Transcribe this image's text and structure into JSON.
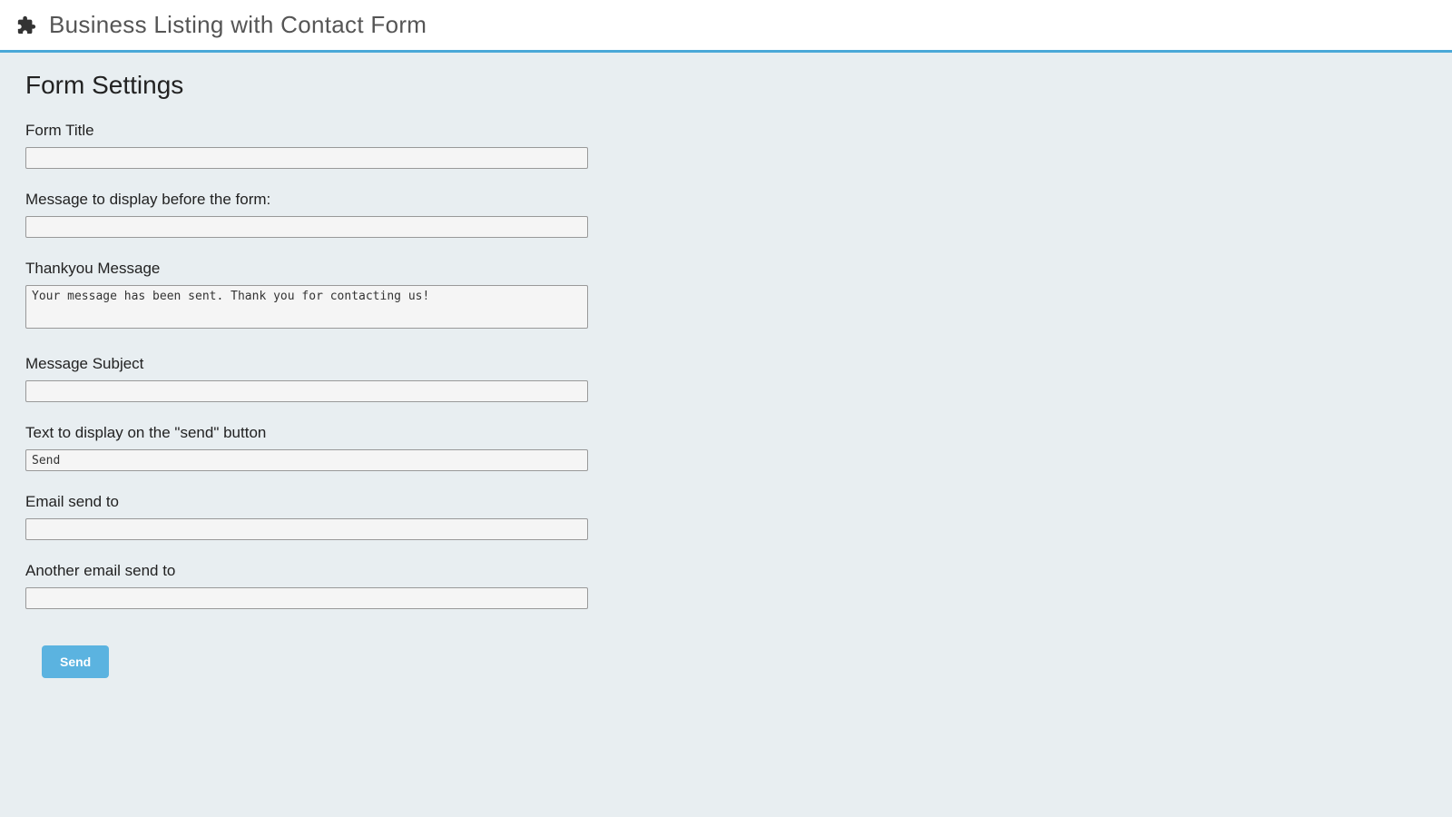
{
  "header": {
    "title": "Business Listing with Contact Form"
  },
  "page": {
    "heading": "Form Settings"
  },
  "form": {
    "form_title": {
      "label": "Form Title",
      "value": ""
    },
    "message_before": {
      "label": "Message to display before the form:",
      "value": ""
    },
    "thankyou": {
      "label": "Thankyou Message",
      "value": "Your message has been sent. Thank you for contacting us!"
    },
    "message_subject": {
      "label": "Message Subject",
      "value": ""
    },
    "send_button_text": {
      "label": "Text to display on the \"send\" button",
      "value": "Send"
    },
    "email_to": {
      "label": "Email send to",
      "value": ""
    },
    "another_email_to": {
      "label": "Another email send to",
      "value": ""
    }
  },
  "actions": {
    "send_label": "Send"
  }
}
